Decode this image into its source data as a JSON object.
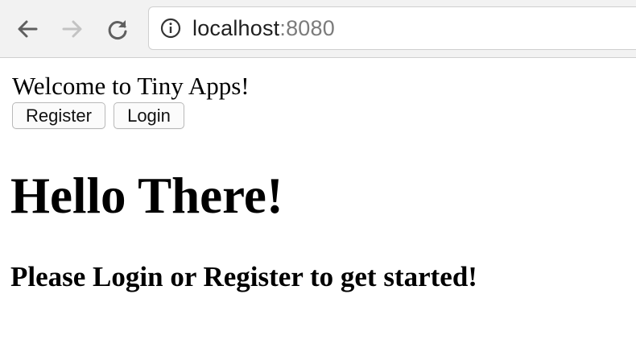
{
  "browser": {
    "url_host": "localhost",
    "url_port": ":8080",
    "icons": {
      "back": "back-arrow-icon",
      "forward": "forward-arrow-icon",
      "reload": "reload-icon",
      "info": "info-icon"
    }
  },
  "page": {
    "welcome_text": "Welcome to Tiny Apps!",
    "register_label": "Register",
    "login_label": "Login",
    "heading": "Hello There!",
    "subheading": "Please Login or Register to get started!"
  },
  "colors": {
    "toolbar_bg": "#f2f2f2",
    "url_port": "#7b7b7b",
    "nav_active": "#5f5f5f",
    "nav_disabled": "#c3c3c3"
  }
}
